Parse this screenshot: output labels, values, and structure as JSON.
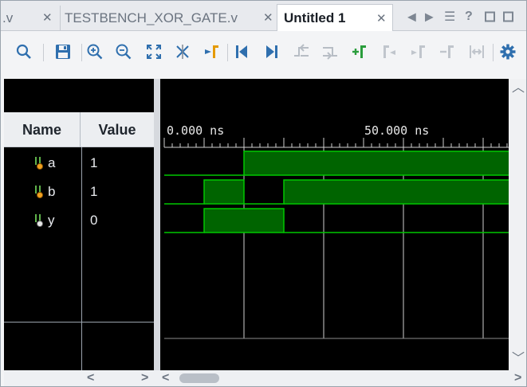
{
  "tabs": [
    {
      "label": ".v",
      "active": false
    },
    {
      "label": "TESTBENCH_XOR_GATE.v",
      "active": false
    },
    {
      "label": "Untitled 1",
      "active": true
    }
  ],
  "tab_controls": [
    "tab-left-icon",
    "tab-right-icon",
    "tab-list-icon",
    "help-icon",
    "restore-icon",
    "close-window-icon"
  ],
  "toolbar_icons": [
    "search-icon",
    "save-icon",
    "zoom-in-icon",
    "zoom-out-icon",
    "zoom-fit-icon",
    "cursor-icon",
    "go-to-cursor-icon",
    "go-to-start-icon",
    "go-to-end-icon",
    "previous-transition-icon",
    "next-transition-icon",
    "add-marker-icon",
    "previous-marker-icon",
    "next-marker-icon",
    "delete-marker-icon",
    "swap-cursors-icon",
    "settings-icon"
  ],
  "columns": {
    "name": "Name",
    "value": "Value"
  },
  "signals": [
    {
      "name": "a",
      "value": "1"
    },
    {
      "name": "b",
      "value": "1"
    },
    {
      "name": "y",
      "value": "0"
    }
  ],
  "timeline": {
    "labels": [
      "0.000 ns",
      "50.000 ns"
    ]
  },
  "colors": {
    "waveform": "#00c800",
    "waveform_fill": "#006400",
    "background": "#000000",
    "gridline": "#d0d0d0"
  }
}
